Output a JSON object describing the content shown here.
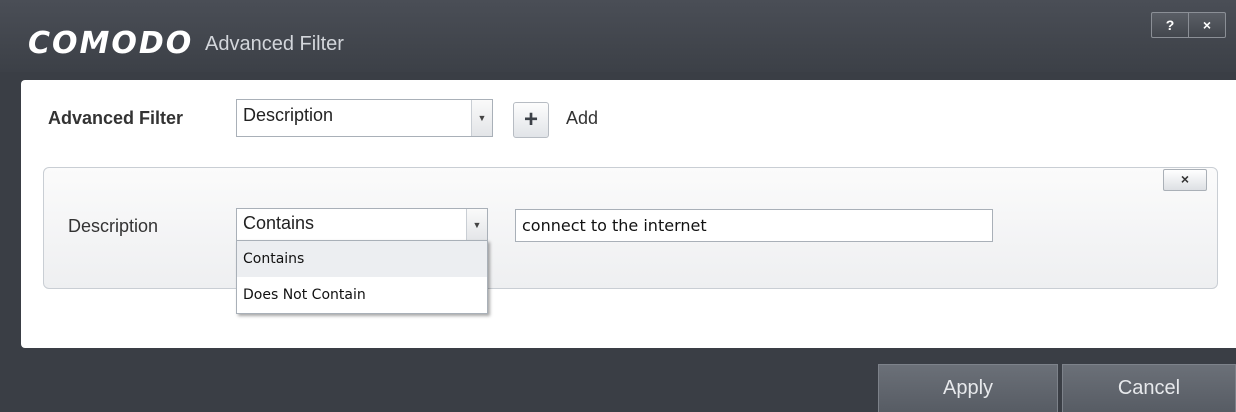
{
  "window": {
    "brand": "COMODO",
    "title": "Advanced Filter",
    "help_label": "?",
    "close_label": "×"
  },
  "filter": {
    "label": "Advanced Filter",
    "field_select_value": "Description",
    "add_label": "Add"
  },
  "row": {
    "label": "Description",
    "operator_value": "Contains",
    "operator_options": [
      "Contains",
      "Does Not Contain"
    ],
    "text_value": "connect to the internet",
    "remove_label": "×"
  },
  "footer": {
    "apply_label": "Apply",
    "cancel_label": "Cancel"
  },
  "icons": {
    "add": "plus-icon",
    "dropdown": "chevron-down-icon",
    "close": "close-icon",
    "help": "help-icon"
  },
  "colors": {
    "chrome": "#3a3e45",
    "panel": "#ffffff",
    "footer_button": "#5f646c"
  }
}
